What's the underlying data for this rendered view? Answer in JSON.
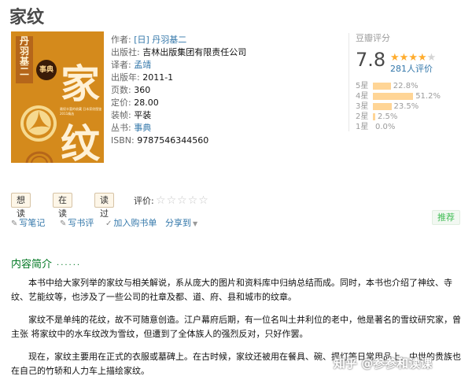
{
  "book": {
    "title": "家纹",
    "cover": {
      "author_vertical": "丹羽基二",
      "badge": "事典",
      "big_chars": [
        "家",
        "纹"
      ],
      "small_text": "最权丰富的收藏 日本家纹图鉴 2011精选"
    },
    "info": {
      "author_label": "作者:",
      "author": "[日] 丹羽基二",
      "publisher_label": "出版社:",
      "publisher": "吉林出版集团有限责任公司",
      "translator_label": "译者:",
      "translator": "孟靖",
      "pubdate_label": "出版年:",
      "pubdate": "2011-1",
      "pages_label": "页数:",
      "pages": "360",
      "price_label": "定价:",
      "price": "28.00",
      "binding_label": "装帧:",
      "binding": "平装",
      "series_label": "丛书:",
      "series": "事典",
      "isbn_label": "ISBN:",
      "isbn": "9787546344560"
    }
  },
  "rating": {
    "header": "豆瓣评分",
    "score": "7.8",
    "stars": 4,
    "count": "281人评价",
    "distribution": [
      {
        "label": "5星",
        "pct": "22.8%",
        "value": 22.8
      },
      {
        "label": "4星",
        "pct": "51.2%",
        "value": 51.2
      },
      {
        "label": "3星",
        "pct": "23.5%",
        "value": 23.5
      },
      {
        "label": "2星",
        "pct": "2.5%",
        "value": 2.5
      },
      {
        "label": "1星",
        "pct": "0.0%",
        "value": 0.0
      }
    ],
    "bar_color": "#ffd596",
    "star_color": "#ffac2d"
  },
  "actions": {
    "want_read": "想读",
    "reading": "在读",
    "read": "读过",
    "rate_label": "评价:",
    "write_note": "写笔记",
    "write_review": "写书评",
    "add_cart": "加入购书单",
    "share": "分享到",
    "recommend": "推荐"
  },
  "intro": {
    "title": "内容简介",
    "dots": "······",
    "paragraphs": [
      "本书中给大家列举的家纹与相关解说，系从庞大的图片和资料库中归纳总结而成。同时，本书也介绍了神纹、寺纹、艺能纹等，也涉及了一些公司的社章及都、道、府、县和城市的纹章。",
      "家纹不是单纯的花纹，故不可随意创造。江户幕府后期，有一位名叫土井利位的老中，他是著名的雪纹研究家，曾主张 将家纹中的水车纹改为雪纹，但遭到了全体族人的强烈反对，只好作罢。",
      "现在，家纹主要用在正式的衣服或墓碑上。在古时候，家纹还被用在餐具、碗、提灯等日常用品上。中世的贵族也在自己的竹轿和人力车上描绘家纹。"
    ]
  },
  "watermark": "知乎 @参参和读课"
}
